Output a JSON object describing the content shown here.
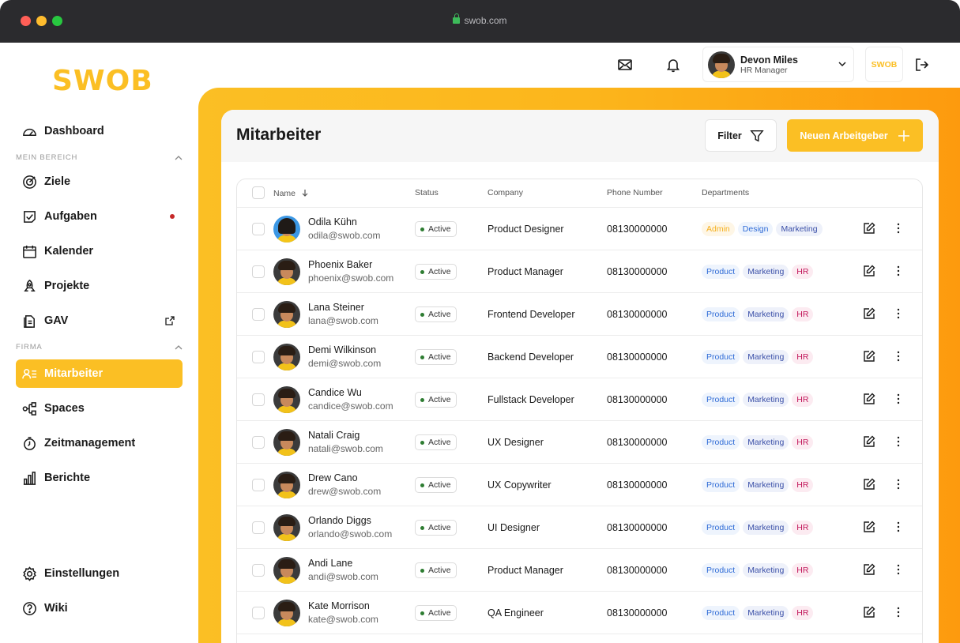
{
  "browser": {
    "url": "swob.com"
  },
  "sidebar": {
    "logo": "SWOB",
    "top_item": "Dashboard",
    "section_mein": "MEIN BEREICH",
    "mein_items": [
      "Ziele",
      "Aufgaben",
      "Kalender",
      "Projekte",
      "GAV"
    ],
    "section_firma": "FIRMA",
    "firma_items": [
      "Mitarbeiter",
      "Spaces",
      "Zeitmanagement",
      "Berichte"
    ],
    "bottom_items": [
      "Einstellungen",
      "Wiki"
    ],
    "active_item": "Mitarbeiter"
  },
  "header": {
    "user_name": "Devon Miles",
    "user_role": "HR Manager",
    "brand_chip": "SWOB",
    "icons": [
      "mail-icon",
      "bell-icon",
      "logout-icon"
    ]
  },
  "page": {
    "title": "Mitarbeiter",
    "filter_label": "Filter",
    "add_label": "Neuen Arbeitgeber"
  },
  "table": {
    "columns": [
      "Name",
      "Status",
      "Company",
      "Phone Number",
      "Departments"
    ],
    "rows": [
      {
        "name": "Odila Kühn",
        "email": "odila@swob.com",
        "status": "Active",
        "company": "Product Designer",
        "phone": "08130000000",
        "departments": [
          "Admin",
          "Design",
          "Marketing"
        ]
      },
      {
        "name": "Phoenix Baker",
        "email": "phoenix@swob.com",
        "status": "Active",
        "company": "Product Manager",
        "phone": "08130000000",
        "departments": [
          "Product",
          "Marketing",
          "HR"
        ]
      },
      {
        "name": "Lana Steiner",
        "email": "lana@swob.com",
        "status": "Active",
        "company": "Frontend Developer",
        "phone": "08130000000",
        "departments": [
          "Product",
          "Marketing",
          "HR"
        ]
      },
      {
        "name": "Demi Wilkinson",
        "email": "demi@swob.com",
        "status": "Active",
        "company": "Backend Developer",
        "phone": "08130000000",
        "departments": [
          "Product",
          "Marketing",
          "HR"
        ]
      },
      {
        "name": "Candice Wu",
        "email": "candice@swob.com",
        "status": "Active",
        "company": "Fullstack Developer",
        "phone": "08130000000",
        "departments": [
          "Product",
          "Marketing",
          "HR"
        ]
      },
      {
        "name": "Natali Craig",
        "email": "natali@swob.com",
        "status": "Active",
        "company": "UX Designer",
        "phone": "08130000000",
        "departments": [
          "Product",
          "Marketing",
          "HR"
        ]
      },
      {
        "name": "Drew Cano",
        "email": "drew@swob.com",
        "status": "Active",
        "company": "UX Copywriter",
        "phone": "08130000000",
        "departments": [
          "Product",
          "Marketing",
          "HR"
        ]
      },
      {
        "name": "Orlando Diggs",
        "email": "orlando@swob.com",
        "status": "Active",
        "company": "UI Designer",
        "phone": "08130000000",
        "departments": [
          "Product",
          "Marketing",
          "HR"
        ]
      },
      {
        "name": "Andi Lane",
        "email": "andi@swob.com",
        "status": "Active",
        "company": "Product Manager",
        "phone": "08130000000",
        "departments": [
          "Product",
          "Marketing",
          "HR"
        ]
      },
      {
        "name": "Kate Morrison",
        "email": "kate@swob.com",
        "status": "Active",
        "company": "QA Engineer",
        "phone": "08130000000",
        "departments": [
          "Product",
          "Marketing",
          "HR"
        ]
      }
    ]
  },
  "colors": {
    "accent": "#fbbf24",
    "gradient_end": "#fd9a0e",
    "status_dot": "#2e7d32",
    "notification_dot": "#c62828"
  }
}
